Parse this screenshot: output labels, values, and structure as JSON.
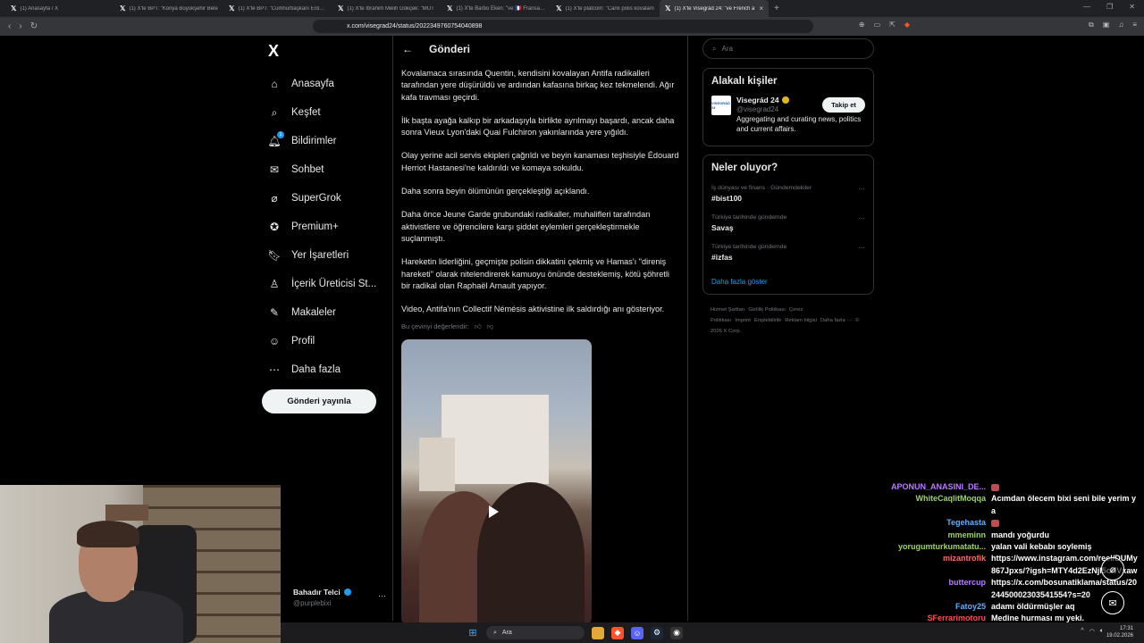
{
  "browser": {
    "tabs": [
      {
        "label": "(1) Anasayfa / X",
        "active": false
      },
      {
        "label": "(1) X'te BPT: \"Konya Büyükşehir Bele",
        "active": false
      },
      {
        "label": "(1) X'te BPT: \"Cumhurbaşkanı Erdoğa",
        "active": false
      },
      {
        "label": "(1) X'te İbrahim Melih Gökçek: \"MUT",
        "active": false
      },
      {
        "label": "(1) X'te Barbo Eken: \"ve 🇫🇷 Fransa Lyo",
        "active": false
      },
      {
        "label": "(1) X'te platcom: \"Canlı polis kovalam",
        "active": false
      },
      {
        "label": "(1) X'te Visegrád 24: \"ve French a",
        "active": true
      }
    ],
    "url": "x.com/visegrad24/status/2022349760754040898"
  },
  "sidebar": {
    "logo": "X",
    "items": [
      {
        "label": "Anasayfa",
        "icon": "home-icon"
      },
      {
        "label": "Keşfet",
        "icon": "search-icon"
      },
      {
        "label": "Bildirimler",
        "icon": "bell-icon",
        "badge": "1"
      },
      {
        "label": "Sohbet",
        "icon": "mail-icon"
      },
      {
        "label": "SuperGrok",
        "icon": "grok-icon"
      },
      {
        "label": "Premium+",
        "icon": "premium-icon"
      },
      {
        "label": "Yer İşaretleri",
        "icon": "bookmark-icon"
      },
      {
        "label": "İçerik Üreticisi St...",
        "icon": "creator-icon"
      },
      {
        "label": "Makaleler",
        "icon": "article-icon"
      },
      {
        "label": "Profil",
        "icon": "person-icon"
      },
      {
        "label": "Daha fazla",
        "icon": "more-icon"
      }
    ],
    "post_button": "Gönderi yayınla",
    "profile": {
      "name": "Bahadır Telci",
      "handle": "@purplebixi"
    }
  },
  "post": {
    "header": "Gönderi",
    "paragraphs": [
      "Kovalamaca sırasında Quentin, kendisini kovalayan Antifa radikalleri tarafından yere düşürüldü ve ardından kafasına birkaç kez tekmelendi. Ağır kafa travması geçirdi.",
      "İlk başta ayağa kalkıp bir arkadaşıyla birlikte ayrılmayı başardı, ancak daha sonra Vieux Lyon'daki Quai Fulchiron yakınlarında yere yığıldı.",
      "Olay yerine acil servis ekipleri çağrıldı ve beyin kanaması teşhisiyle Édouard Herriot Hastanesi'ne kaldırıldı ve komaya sokuldu.",
      "Daha sonra beyin ölümünün gerçekleştiği açıklandı.",
      "Daha önce Jeune Garde grubundaki radikaller, muhalifleri tarafından aktivistlere ve öğrencilere karşı şiddet eylemleri gerçekleştirmekle suçlanmıştı.",
      "Hareketin liderliğini, geçmişte polisin dikkatini çekmiş ve Hamas'ı \"direniş hareketi\" olarak nitelendirerek kamuoyu önünde desteklemiş, kötü şöhretli bir radikal olan Raphaël Arnault yapıyor.",
      "Video, Antifa'nın Collectif Némésis aktivistine ilk saldırdığı anı gösteriyor."
    ],
    "rate_translation": "Bu çeviriyi değerlendir:"
  },
  "right": {
    "search_placeholder": "Ara",
    "related_title": "Alakalı kişiler",
    "related": {
      "name": "Visegrád 24",
      "handle": "@visegrad24",
      "desc": "Aggregating and curating news, politics and current affairs.",
      "follow": "Takip et",
      "avatar_text": "VISEGRÁD 24"
    },
    "trends_title": "Neler oluyor?",
    "trends": [
      {
        "meta": "İş dünyası ve finans · Gündemdekiler",
        "topic": "#bist100"
      },
      {
        "meta": "Türkiye tarihinde gündemde",
        "topic": "Savaş"
      },
      {
        "meta": "Türkiye tarihinde gündemde",
        "topic": "#izfas"
      }
    ],
    "show_more": "Daha fazla göster",
    "footer_links": [
      "Hizmet Şartları",
      "Gizlilik Politikası",
      "Çerez Politikası",
      "Imprint",
      "Erişilebilirlik",
      "Reklam bilgisi",
      "Daha fazla ···",
      "© 2026 X Corp."
    ]
  },
  "chat": [
    {
      "user": "APONUN_ANASINI_DE...",
      "color": "#b77cff",
      "msg": "",
      "emote": true
    },
    {
      "user": "WhiteCaqlitMoqqa",
      "color": "#9bd36a",
      "msg": "Acımdan ölecem bixi seni bile yerim ya",
      "emote": false
    },
    {
      "user": "Tegehasta",
      "color": "#5fb0ff",
      "msg": "",
      "emote": true
    },
    {
      "user": "mmeminn",
      "color": "#9bd36a",
      "msg": "mandı yoğurdu",
      "emote": false
    },
    {
      "user": "yorugumturkumatatu...",
      "color": "#9bd36a",
      "msg": "yalan vali kebabı soylemiş",
      "emote": false
    },
    {
      "user": "mizantrofik",
      "color": "#ff6b6b",
      "msg": "https://www.instagram.com/reel/DUMy867Jpxs/?igsh=MTY4d2EzNjl5cHVxaw",
      "emote": false
    },
    {
      "user": "buttercup",
      "color": "#b77cff",
      "msg": "https://x.com/bosunatiklama/status/2024450002303541554?s=20",
      "emote": false
    },
    {
      "user": "Fatoy25",
      "color": "#5fb0ff",
      "msg": "adamı öldürmüşler aq",
      "emote": false
    },
    {
      "user": "SFerrarimotoru",
      "color": "#ff4d4d",
      "msg": "Medine hurması mı yeki.",
      "emote": false
    }
  ],
  "taskbar": {
    "search": "Ara",
    "time": "17:31",
    "date": "19.02.2026"
  }
}
